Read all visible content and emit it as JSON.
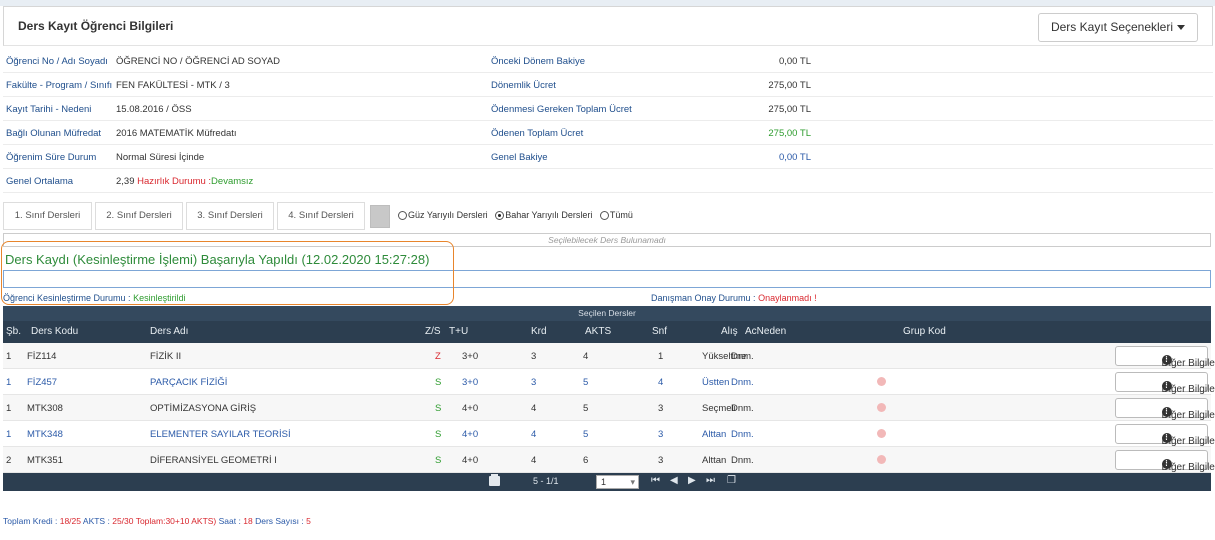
{
  "header": {
    "title": "Ders Kayıt  Öğrenci Bilgileri",
    "options_button": "Ders Kayıt Seçenekleri"
  },
  "info": {
    "rows": [
      {
        "label1": "Öğrenci No / Adı Soyadı",
        "value1": "ÖĞRENCİ NO / ÖĞRENCİ AD SOYAD",
        "label2": "Önceki Dönem Bakiye",
        "value2": "0,00 TL"
      },
      {
        "label1": "Fakülte - Program / Sınıfı",
        "value1": "FEN FAKÜLTESİ - MTK / 3",
        "label2": "Dönemlik Ücret",
        "value2": "275,00 TL"
      },
      {
        "label1": "Kayıt Tarihi - Nedeni",
        "value1": "15.08.2016 / ÖSS",
        "label2": "Ödenmesi Gereken Toplam Ücret",
        "value2": "275,00 TL"
      },
      {
        "label1": "Bağlı Olunan Müfredat",
        "value1": "2016 MATEMATİK Müfredatı",
        "label2": "Ödenen Toplam Ücret",
        "value2": "275,00 TL"
      },
      {
        "label1": "Öğrenim Süre Durum",
        "value1": "Normal Süresi İçinde",
        "label2": "Genel Bakiye",
        "value2": "0,00 TL"
      }
    ],
    "gpa_label": "Genel Ortalama",
    "gpa_value": "2,39",
    "prep_label": "Hazırlık Durumu :",
    "prep_value": "Devamsız"
  },
  "class_tabs": [
    "1. Sınıf Dersleri",
    "2. Sınıf Dersleri",
    "3. Sınıf Dersleri",
    "4. Sınıf Dersleri"
  ],
  "semester_filter": {
    "options": [
      "Güz Yarıyılı Dersleri",
      "Bahar Yarıyılı Dersleri",
      "Tümü"
    ],
    "selected": "Bahar Yarıyılı Dersleri"
  },
  "no_selectable": "Seçilebilecek Ders Bulunamadı",
  "success_message": "Ders Kaydı (Kesinleştirme İşlemi) Başarıyla Yapıldı (12.02.2020 15:27:28)",
  "status": {
    "student_label": "Öğrenci Kesinleştirme Durumu :",
    "student_value": "Kesinleştirildi",
    "advisor_label": "Danışman Onay Durumu :",
    "advisor_value": "Onaylanmadı !"
  },
  "table": {
    "caption": "Seçilen Dersler",
    "headers": {
      "sb": "Şb.",
      "code": "Ders Kodu",
      "name": "Ders Adı",
      "zs": "Z/S",
      "tu": "T+U",
      "krd": "Krd",
      "akts": "AKTS",
      "snf": "Snf",
      "alis": "Alış",
      "acneden": "AcNeden",
      "grup": "Grup Kod"
    },
    "more_button": "Diğer Bilgiler",
    "rows": [
      {
        "sb": "1",
        "code": "FİZ114",
        "name": "FİZİK II",
        "zs": "Z",
        "tu": "3+0",
        "krd": "3",
        "akts": "4",
        "snf": "1",
        "alis": "Yükseltme",
        "acneden": "Dnm.",
        "blue": false,
        "warn": false
      },
      {
        "sb": "1",
        "code": "FİZ457",
        "name": "PARÇACIK FİZİĞİ",
        "zs": "S",
        "tu": "3+0",
        "krd": "3",
        "akts": "5",
        "snf": "4",
        "alis": "Üstten",
        "acneden": "Dnm.",
        "blue": true,
        "warn": true
      },
      {
        "sb": "1",
        "code": "MTK308",
        "name": "OPTİMİZASYONA GİRİŞ",
        "zs": "S",
        "tu": "4+0",
        "krd": "4",
        "akts": "5",
        "snf": "3",
        "alis": "Seçmeli",
        "acneden": "Dnm.",
        "blue": false,
        "warn": true
      },
      {
        "sb": "1",
        "code": "MTK348",
        "name": "ELEMENTER SAYILAR TEORİSİ",
        "zs": "S",
        "tu": "4+0",
        "krd": "4",
        "akts": "5",
        "snf": "3",
        "alis": "Alttan",
        "acneden": "Dnm.",
        "blue": true,
        "warn": true
      },
      {
        "sb": "2",
        "code": "MTK351",
        "name": "DİFERANSİYEL GEOMETRİ I",
        "zs": "S",
        "tu": "4+0",
        "krd": "4",
        "akts": "6",
        "snf": "3",
        "alis": "Alttan",
        "acneden": "Dnm.",
        "blue": false,
        "warn": true
      }
    ]
  },
  "pager": {
    "info": "5 - 1/1",
    "page": "1"
  },
  "footer": {
    "kredi_label": "Toplam Kredi :",
    "kredi_value": "18/25",
    "akts_label": "AKTS :",
    "akts_value": "25/30 Toplam:30+10 AKTS)",
    "saat_label": "Saat :",
    "saat_value": "18",
    "count_label": "Ders Sayısı :",
    "count_value": "5"
  },
  "colors": {
    "header_dark": "#2c3e50",
    "label_blue": "#1f4e8c",
    "success_green": "#2e8b3a",
    "alert_red": "#d9282f",
    "highlight_orange": "#e8852c"
  }
}
